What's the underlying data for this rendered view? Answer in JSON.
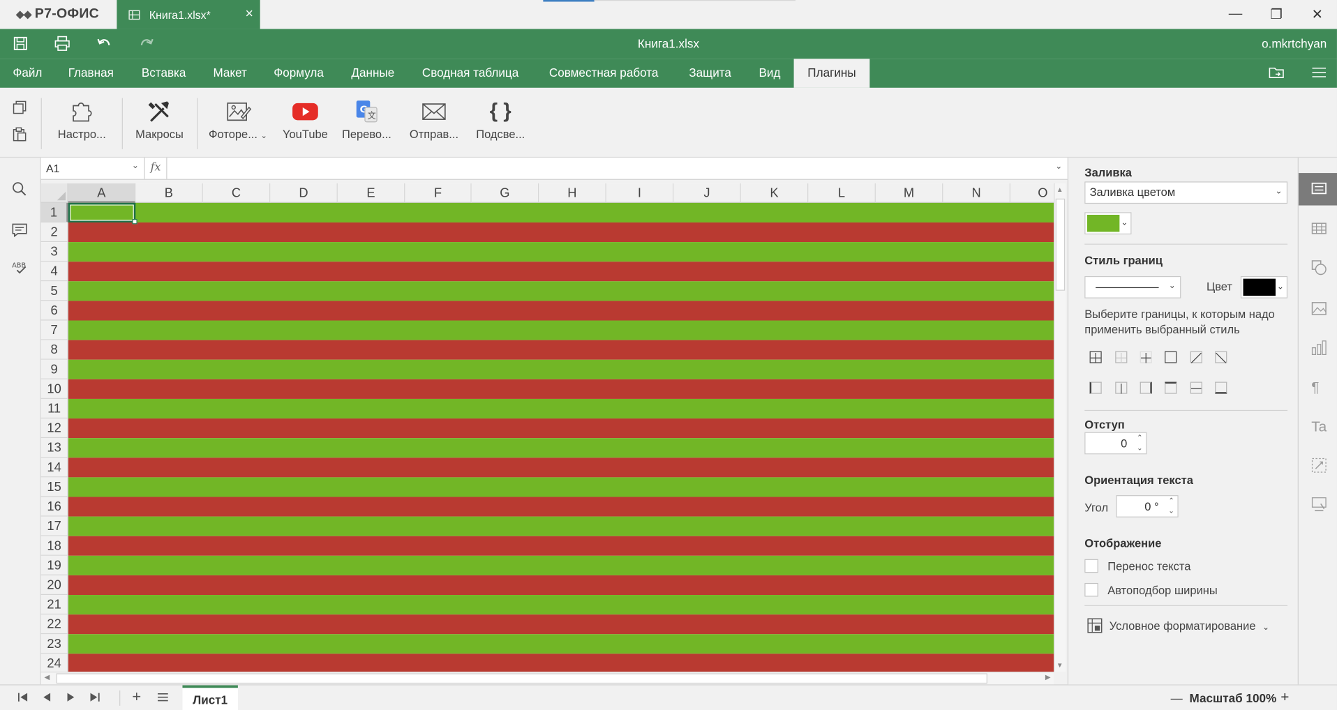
{
  "app": {
    "logo": "Р7-ОФИС",
    "doc_tab": "Книга1.xlsx*",
    "title": "Книга1.xlsx",
    "user": "o.mkrtchyan"
  },
  "window_controls": {
    "minimize": "—",
    "restore": "❐",
    "close": "✕"
  },
  "menu": {
    "tabs": [
      "Файл",
      "Главная",
      "Вставка",
      "Макет",
      "Формула",
      "Данные",
      "Сводная таблица",
      "Совместная работа",
      "Защита",
      "Вид",
      "Плагины"
    ],
    "active": "Плагины"
  },
  "toolbar": {
    "buttons": [
      {
        "label": "Настро...",
        "icon": "puzzle-icon"
      },
      {
        "label": "Макросы",
        "icon": "tools-icon"
      },
      {
        "label": "Фоторе...",
        "icon": "photo-edit-icon"
      },
      {
        "label": "YouTube",
        "icon": "youtube-icon"
      },
      {
        "label": "Перево...",
        "icon": "translate-icon"
      },
      {
        "label": "Отправ...",
        "icon": "mail-icon"
      },
      {
        "label": "Подсве...",
        "icon": "braces-icon"
      }
    ]
  },
  "formula_bar": {
    "cell_ref": "A1",
    "fx_label": "fx",
    "value": ""
  },
  "grid": {
    "columns": [
      "A",
      "B",
      "C",
      "D",
      "E",
      "F",
      "G",
      "H",
      "I",
      "J",
      "K",
      "L",
      "M",
      "N",
      "O"
    ],
    "rows": [
      "1",
      "2",
      "3",
      "4",
      "5",
      "6",
      "7",
      "8",
      "9",
      "10",
      "11",
      "12",
      "13",
      "14",
      "15",
      "16",
      "17",
      "18",
      "19",
      "20",
      "21",
      "22",
      "23",
      "24"
    ],
    "selected_cell": "A1",
    "colors": {
      "green": "#72b626",
      "red": "#b93a31"
    }
  },
  "status": {
    "sheet_tab": "Лист1",
    "zoom_label": "Масштаб 100%",
    "zoom_minus": "—",
    "zoom_plus": "+"
  },
  "panel": {
    "fill_title": "Заливка",
    "fill_type": "Заливка цветом",
    "fill_color": "#72b626",
    "border_style_title": "Стиль границ",
    "border_color_label": "Цвет",
    "border_color": "#000000",
    "border_hint": "Выберите границы, к которым надо применить выбранный стиль",
    "indent_title": "Отступ",
    "indent_value": "0",
    "orientation_title": "Ориентация текста",
    "angle_label": "Угол",
    "angle_value": "0 °",
    "display_title": "Отображение",
    "wrap_text": "Перенос текста",
    "autofit": "Автоподбор ширины",
    "conditional": "Условное форматирование"
  }
}
